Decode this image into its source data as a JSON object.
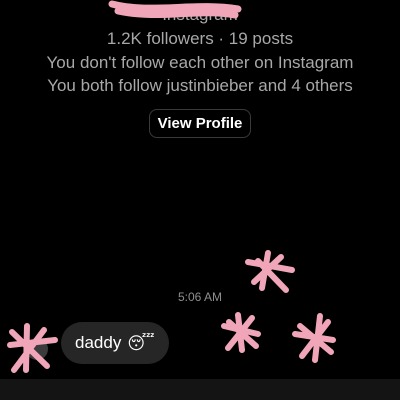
{
  "profile": {
    "subtitle": "Instagram",
    "stats": "1.2K followers · 19 posts",
    "follow_status": "You don't follow each other on Instagram",
    "mutuals": "You both follow justinbieber and 4 others",
    "view_profile_label": "View Profile"
  },
  "thread": {
    "timestamp": "5:06 AM",
    "messages": [
      {
        "text": "daddy",
        "emoji": "😴"
      }
    ]
  },
  "colors": {
    "background": "#000000",
    "secondary_text": "#a8a8a8",
    "bubble": "#262626",
    "scribble": "#f0a6b8"
  }
}
